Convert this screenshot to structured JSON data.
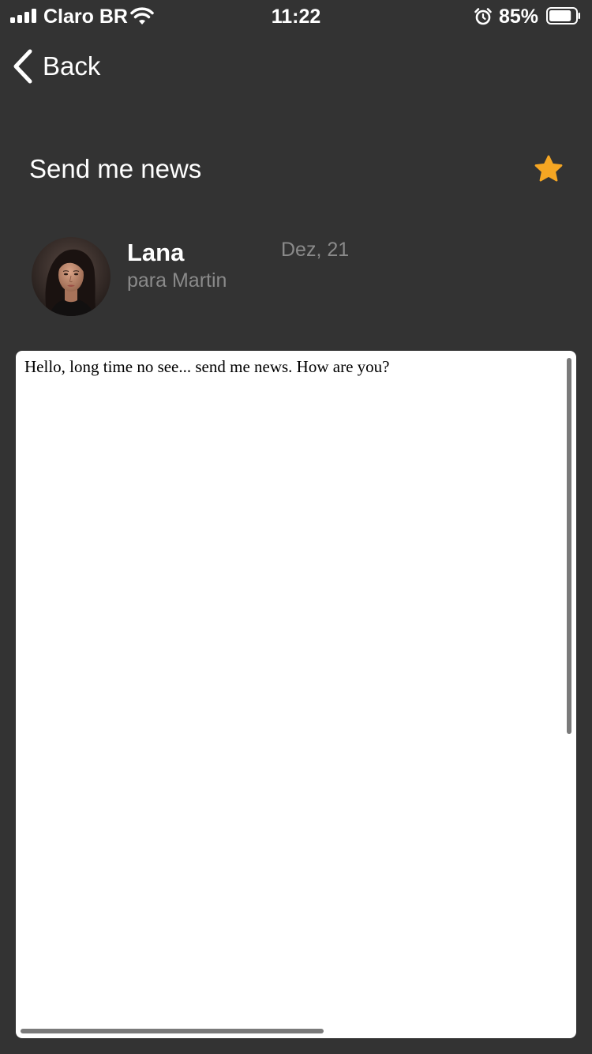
{
  "status_bar": {
    "carrier": "Claro BR",
    "time": "11:22",
    "battery_percent": "85%",
    "battery_level": 0.85,
    "icons": [
      "signal-icon",
      "wifi-icon",
      "alarm-icon",
      "battery-icon"
    ]
  },
  "nav": {
    "back_label": "Back",
    "back_icon": "chevron-left-icon"
  },
  "email": {
    "subject": "Send me news",
    "starred": true,
    "star_color": "#f5a623",
    "sender": "Lana",
    "recipient": "para Martin",
    "date": "Dez, 21",
    "body": "Hello, long time no see... send me news. How are you?"
  },
  "colors": {
    "background": "#333333",
    "text_primary": "#ffffff",
    "text_secondary": "#8a8a8a",
    "message_bg": "#ffffff"
  }
}
